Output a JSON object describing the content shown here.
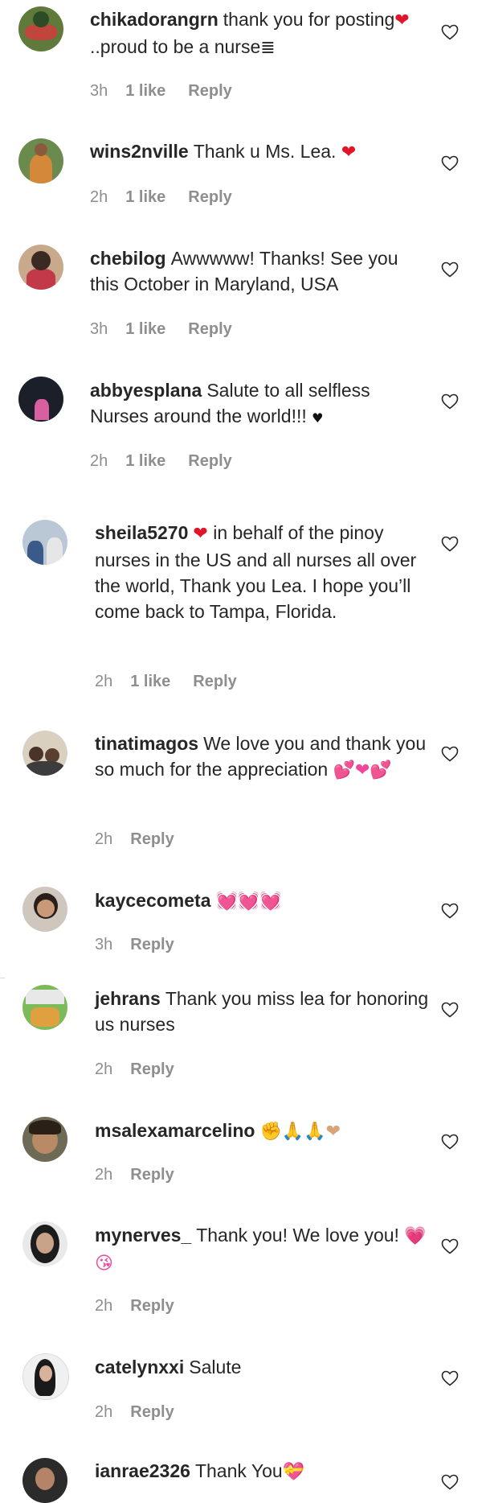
{
  "comments": [
    {
      "user": "chikadorangrn",
      "text_parts": [
        "thank you for posting",
        "❤",
        " ..proud to be a nurse",
        "≣"
      ],
      "time": "3h",
      "likes": "1 like",
      "reply": "Reply"
    },
    {
      "user": "wins2nville",
      "text_parts": [
        "Thank u Ms. Lea. ",
        "❤"
      ],
      "time": "2h",
      "likes": "1 like",
      "reply": "Reply"
    },
    {
      "user": "chebilog",
      "text_parts": [
        "Awwwww! Thanks! See you this October in Maryland, USA"
      ],
      "time": "3h",
      "likes": "1 like",
      "reply": "Reply"
    },
    {
      "user": "abbyesplana",
      "text_parts": [
        "Salute to all selfless Nurses around the world!!! ",
        "♥"
      ],
      "time": "2h",
      "likes": "1 like",
      "reply": "Reply"
    },
    {
      "user": "sheila5270",
      "text_parts": [
        "❤",
        " in behalf of the pinoy nurses in the US and all nurses all over the world, Thank you Lea. I hope you’ll come back to Tampa, Florida."
      ],
      "time": "2h",
      "likes": "1 like",
      "reply": "Reply"
    },
    {
      "user": "tinatimagos",
      "text_parts": [
        "We love you and thank you so much for the appreciation ",
        "💕❤💕"
      ],
      "time": "2h",
      "likes": "",
      "reply": "Reply"
    },
    {
      "user": "kaycecometa",
      "text_parts": [
        "💓💓💓"
      ],
      "time": "3h",
      "likes": "",
      "reply": "Reply"
    },
    {
      "user": "jehrans",
      "text_parts": [
        "Thank you miss lea for honoring us nurses"
      ],
      "time": "2h",
      "likes": "",
      "reply": "Reply"
    },
    {
      "user": "msalexamarcelino",
      "text_parts": [
        "✊🙏🙏❤"
      ],
      "time": "2h",
      "likes": "",
      "reply": "Reply"
    },
    {
      "user": "mynerves_",
      "text_parts": [
        "Thank you! We love you! ",
        "💗 😘"
      ],
      "time": "2h",
      "likes": "",
      "reply": "Reply"
    },
    {
      "user": "catelynxxi",
      "text_parts": [
        "Salute"
      ],
      "time": "2h",
      "likes": "",
      "reply": "Reply"
    },
    {
      "user": "ianrae2326",
      "text_parts": [
        "Thank You",
        "💝"
      ],
      "time": "",
      "likes": "",
      "reply": ""
    }
  ],
  "icons": {
    "heart": "heart-outline-icon",
    "avatar": "avatar"
  },
  "colors": {
    "text": "#262626",
    "meta": "#8e8e8e",
    "heart_emoji": "#e0152a",
    "pink_emoji": "#f0479a"
  }
}
